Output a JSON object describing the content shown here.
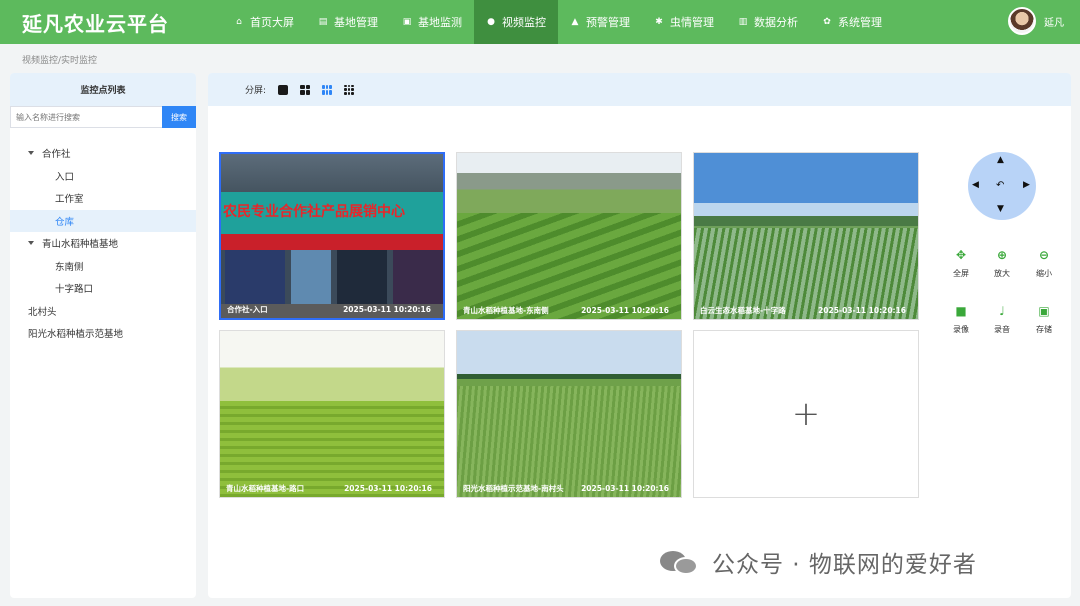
{
  "app": {
    "title": "延凡农业云平台"
  },
  "nav": [
    {
      "label": "首页大屏",
      "icon": "home-icon",
      "glyph": "⌂"
    },
    {
      "label": "基地管理",
      "icon": "map-icon",
      "glyph": "▤"
    },
    {
      "label": "基地监测",
      "icon": "monitor-icon",
      "glyph": "▣"
    },
    {
      "label": "视频监控",
      "icon": "location-icon",
      "glyph": "●",
      "active": true
    },
    {
      "label": "预警管理",
      "icon": "alarm-icon",
      "glyph": "▲"
    },
    {
      "label": "虫情管理",
      "icon": "bug-icon",
      "glyph": "✱"
    },
    {
      "label": "数据分析",
      "icon": "chart-icon",
      "glyph": "▥"
    },
    {
      "label": "系统管理",
      "icon": "gear-icon",
      "glyph": "✿"
    }
  ],
  "user": {
    "name": "延凡"
  },
  "breadcrumb": "视频监控/实时监控",
  "sidebar": {
    "title": "监控点列表",
    "search_placeholder": "输入名称进行搜索",
    "search_button": "搜索",
    "tree": [
      {
        "label": "合作社",
        "level": 0,
        "expanded": true
      },
      {
        "label": "入口",
        "level": 1
      },
      {
        "label": "工作室",
        "level": 1
      },
      {
        "label": "仓库",
        "level": 1,
        "selected": true
      },
      {
        "label": "青山水稻种植基地",
        "level": 0,
        "expanded": true
      },
      {
        "label": "东南侧",
        "level": 1
      },
      {
        "label": "十字路口",
        "level": 1
      },
      {
        "label": "北村头",
        "level": 0
      },
      {
        "label": "阳光水稻种植示范基地",
        "level": 0
      }
    ]
  },
  "toolbar": {
    "split_label": "分屏:",
    "split_options": [
      "1",
      "4",
      "6",
      "9"
    ],
    "active_split": "6"
  },
  "videos": [
    {
      "name": "合作社-入口",
      "time": "2025-03-11 10:20:16",
      "sign_text": "农民专业合作社产品展销中心"
    },
    {
      "name": "青山水稻种植基地-东南侧",
      "time": "2025-03-11 10:20:16"
    },
    {
      "name": "白云生态水稻基地-十字路",
      "time": "2025-03-11 10:20:16"
    },
    {
      "name": "青山水稻种植基地-路口",
      "time": "2025-03-11 10:20:16"
    },
    {
      "name": "阳光水稻种植示范基地-南村头",
      "time": "2025-03-11 10:20:16"
    }
  ],
  "empty_slot": {
    "symbol": "+"
  },
  "ptz": {
    "up": "▲",
    "down": "▼",
    "left": "◀",
    "right": "▶",
    "center": "↶"
  },
  "controls": [
    {
      "label": "全屏",
      "icon": "fullscreen-icon",
      "glyph": "✥"
    },
    {
      "label": "放大",
      "icon": "zoom-in-icon",
      "glyph": "⊕"
    },
    {
      "label": "缩小",
      "icon": "zoom-out-icon",
      "glyph": "⊖"
    },
    {
      "label": "录像",
      "icon": "video-record-icon",
      "glyph": "■"
    },
    {
      "label": "录音",
      "icon": "microphone-icon",
      "glyph": "♩"
    },
    {
      "label": "存储",
      "icon": "save-icon",
      "glyph": "▣"
    }
  ],
  "watermark": "公众号 · 物联网的爱好者"
}
